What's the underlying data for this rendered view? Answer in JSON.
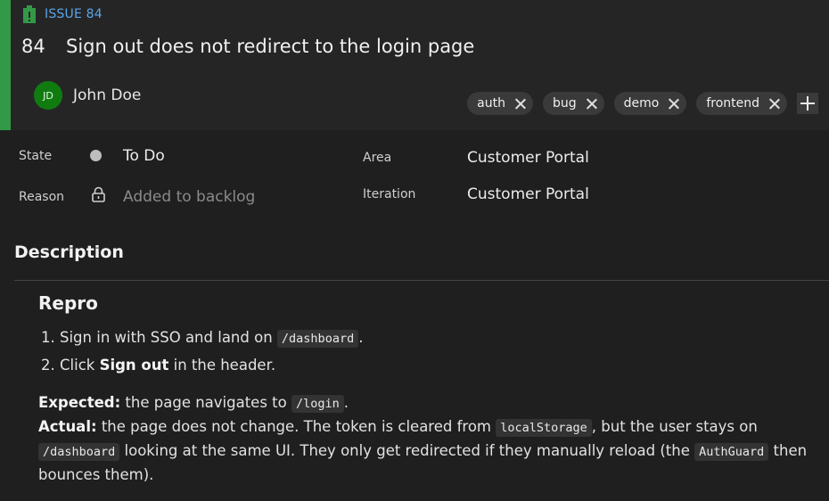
{
  "issue": {
    "type_label": "ISSUE 84",
    "number": "84",
    "title": "Sign out does not redirect to the login page",
    "assignee": {
      "initials": "JD",
      "name": "John Doe"
    },
    "tags": [
      "auth",
      "bug",
      "demo",
      "frontend"
    ]
  },
  "fields": {
    "state_label": "State",
    "state_value": "To Do",
    "reason_label": "Reason",
    "reason_value": "Added to backlog",
    "area_label": "Area",
    "area_value": "Customer Portal",
    "iteration_label": "Iteration",
    "iteration_value": "Customer Portal"
  },
  "description": {
    "header": "Description",
    "repro_heading": "Repro",
    "step1_text": "Sign in with SSO and land on ",
    "step1_code": "/dashboard",
    "step1_end": ".",
    "step2_pre": "Click ",
    "step2_bold": "Sign out",
    "step2_post": " in the header.",
    "expected_label": "Expected:",
    "expected_text": " the page navigates to ",
    "expected_code": "/login",
    "expected_end": ".",
    "actual_label": "Actual:",
    "actual_text1": " the page does not change. The token is cleared from ",
    "actual_code1": "localStorage",
    "actual_text2": ", but the user stays on ",
    "actual_code2": "/dashboard",
    "actual_text3": " looking at the same UI. They only get redirected if they manually reload (the ",
    "actual_code3": "AuthGuard",
    "actual_text4": " then bounces them)."
  },
  "colors": {
    "accent_green": "#339947",
    "issue_type_blue": "#5aa6e8",
    "avatar_green": "#107c10"
  },
  "icons": {
    "issue_type": "clipboard-icon",
    "state": "state-dot-icon",
    "reason": "lock-icon",
    "tag_remove": "close-icon",
    "add_tag": "plus-icon"
  }
}
